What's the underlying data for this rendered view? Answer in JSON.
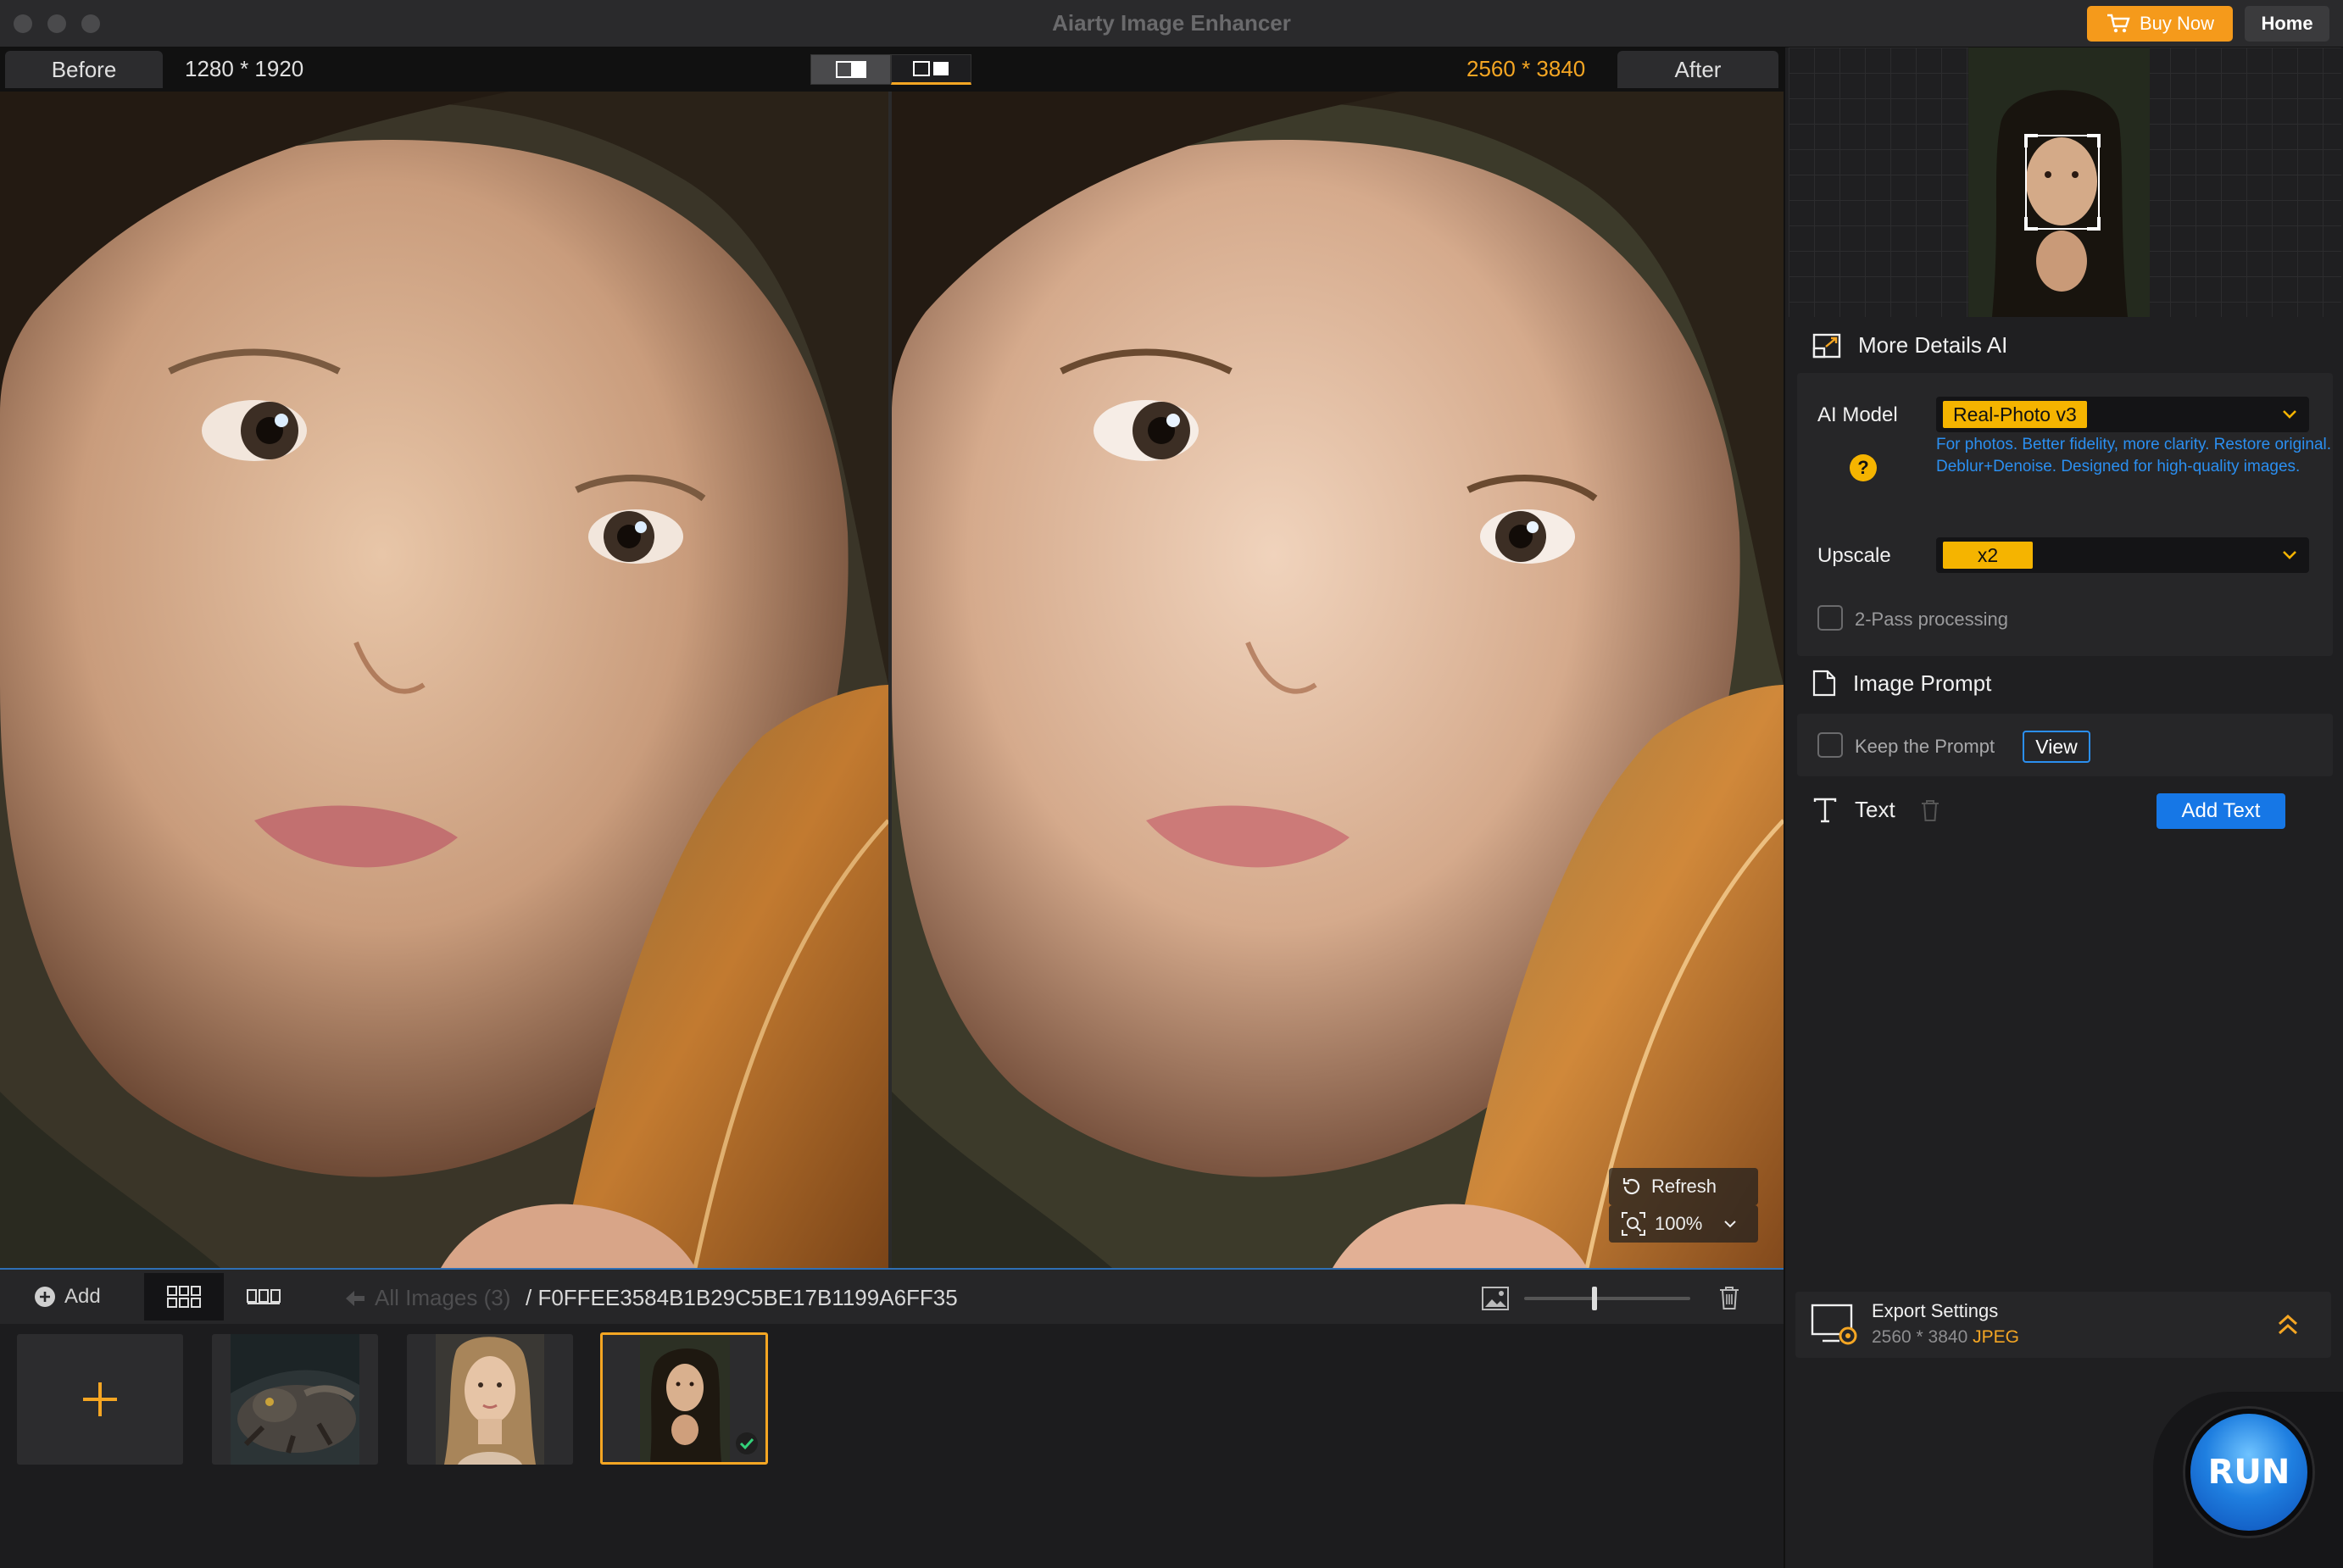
{
  "window": {
    "title": "Aiarty Image Enhancer",
    "buy_label": "Buy Now",
    "home_label": "Home"
  },
  "compare": {
    "before_label": "Before",
    "before_size": "1280 * 1920",
    "after_size": "2560 * 3840",
    "after_label": "After"
  },
  "overlay": {
    "refresh_label": "Refresh",
    "zoom": "100%"
  },
  "toolbar": {
    "add_label": "Add",
    "all_images": "All Images (3)",
    "folder_id": "/ F0FFEE3584B1B29C5BE17B1199A6FF35"
  },
  "settings": {
    "section_title": "More Details AI",
    "ai_model_label": "AI Model",
    "ai_model_value": "Real-Photo v3",
    "ai_model_desc": "For photos. Better fidelity, more clarity. Restore original. Deblur+Denoise. Designed for high-quality images.",
    "upscale_label": "Upscale",
    "upscale_value": "x2",
    "two_pass_label": "2-Pass processing",
    "image_prompt_title": "Image Prompt",
    "keep_prompt_label": "Keep the Prompt",
    "view_label": "View",
    "text_title": "Text",
    "add_text_label": "Add Text"
  },
  "export": {
    "title": "Export Settings",
    "size": "2560 * 3840",
    "format": "JPEG"
  },
  "run_label": "RUN",
  "colors": {
    "accent": "#f5a623",
    "blue": "#1677e6",
    "link_blue": "#2b8ff0"
  }
}
